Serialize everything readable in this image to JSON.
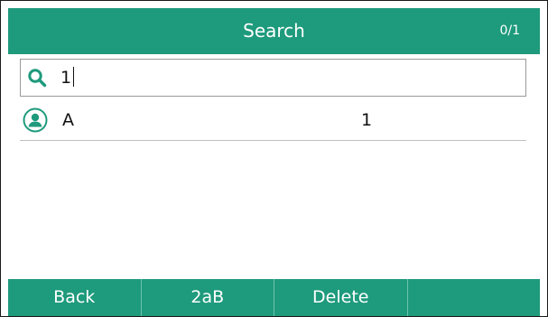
{
  "header": {
    "title": "Search",
    "counter": "0/1"
  },
  "search": {
    "value": "1",
    "icon": "search-icon"
  },
  "results": [
    {
      "name": "A",
      "number": "1",
      "icon": "contact-icon"
    }
  ],
  "softkeys": [
    {
      "label": "Back"
    },
    {
      "label": "2aB"
    },
    {
      "label": "Delete"
    },
    {
      "label": ""
    }
  ],
  "colors": {
    "accent": "#1e9a7c",
    "text": "#111111",
    "divider": "#bfbfbf"
  }
}
